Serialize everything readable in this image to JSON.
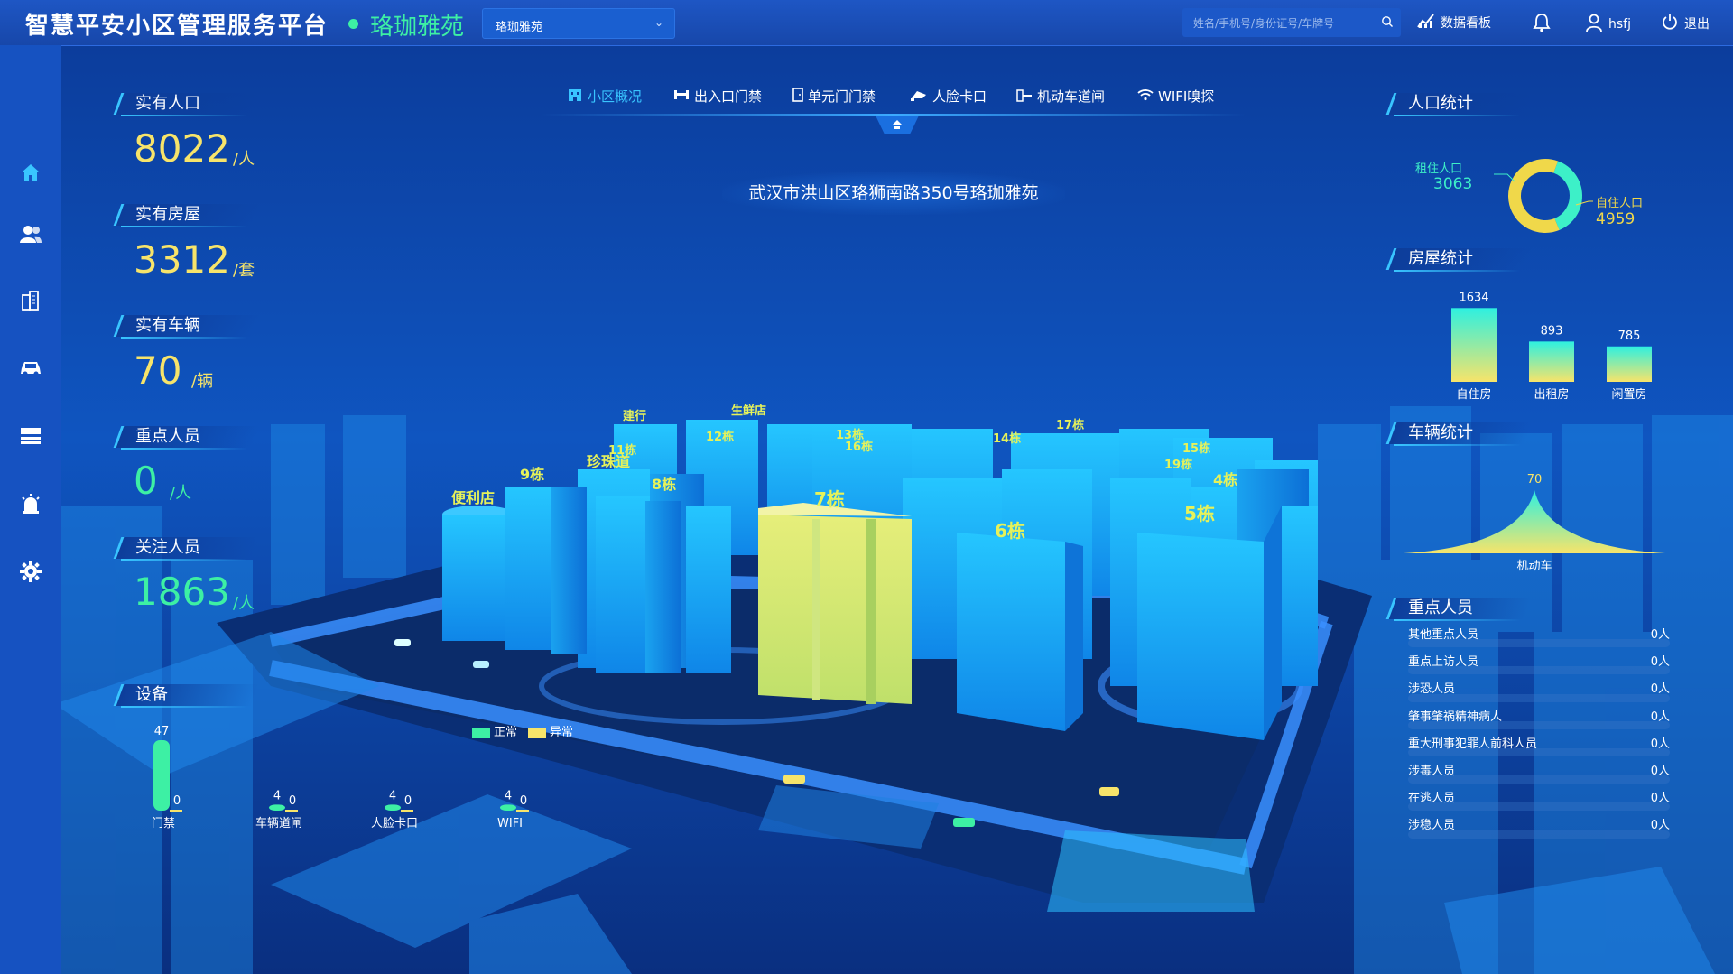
{
  "header": {
    "app_title": "智慧平安小区管理服务平台",
    "site_name": "珞珈雅苑",
    "site_select_value": "珞珈雅苑",
    "search_placeholder": "姓名/手机号/身份证号/车牌号",
    "dashboard_label": "数据看板",
    "username": "hsfj",
    "logout_label": "退出"
  },
  "sidebar": {
    "items": [
      "home-icon",
      "people-icon",
      "building-icon",
      "car-icon",
      "list-icon",
      "alarm-icon",
      "settings-icon"
    ]
  },
  "stats": [
    {
      "label": "实有人口",
      "value": "8022",
      "unit": "/人",
      "color": "#f7e46a"
    },
    {
      "label": "实有房屋",
      "value": "3312",
      "unit": "/套",
      "color": "#f7e46a"
    },
    {
      "label": "实有车辆",
      "value": "70",
      "unit": "/辆",
      "color": "#f7e46a"
    },
    {
      "label": "重点人员",
      "value": "0",
      "unit": "/人",
      "color": "#3df0a4"
    },
    {
      "label": "关注人员",
      "value": "1863",
      "unit": "/人",
      "color": "#3df0a4"
    }
  ],
  "nav_tabs": [
    {
      "label": "小区概况",
      "icon": "building-icon",
      "active": true
    },
    {
      "label": "出入口门禁",
      "icon": "gate-icon",
      "active": false
    },
    {
      "label": "单元门门禁",
      "icon": "door-icon",
      "active": false
    },
    {
      "label": "人脸卡口",
      "icon": "camera-icon",
      "active": false
    },
    {
      "label": "机动车道闸",
      "icon": "barrier-icon",
      "active": false
    },
    {
      "label": "WIFI嗅探",
      "icon": "wifi-icon",
      "active": false
    }
  ],
  "address": "武汉市洪山区珞狮南路350号珞珈雅苑",
  "building_labels": [
    "便利店",
    "9栋",
    "8栋",
    "7栋",
    "6栋",
    "5栋",
    "4栋",
    "建行",
    "生鲜店",
    "珍珠道",
    "11栋",
    "12栋",
    "13栋",
    "16栋",
    "14栋",
    "17栋",
    "15栋",
    "19栋"
  ],
  "legend": {
    "normal": "正常",
    "abnormal": "异常",
    "normal_color": "#3df0a4",
    "abnormal_color": "#f7e46a"
  },
  "devices": {
    "title": "设备",
    "items": [
      {
        "name": "门禁",
        "normal": 47,
        "abnormal": 0
      },
      {
        "name": "车辆道闸",
        "normal": 4,
        "abnormal": 0
      },
      {
        "name": "人脸卡口",
        "normal": 4,
        "abnormal": 0
      },
      {
        "name": "WIFI",
        "normal": 4,
        "abnormal": 0
      }
    ]
  },
  "population_chart": {
    "title": "人口统计",
    "chart_data": {
      "type": "pie",
      "categories": [
        "租住人口",
        "自住人口"
      ],
      "values": [
        3063,
        4959
      ],
      "colors": [
        "#3df0c8",
        "#f0d84a"
      ]
    }
  },
  "housing_chart": {
    "title": "房屋统计",
    "chart_data": {
      "type": "bar",
      "categories": [
        "自住房",
        "出租房",
        "闲置房"
      ],
      "values": [
        1634,
        893,
        785
      ]
    }
  },
  "vehicle_chart": {
    "title": "车辆统计",
    "chart_data": {
      "type": "area",
      "categories": [
        "机动车"
      ],
      "values": [
        70
      ]
    }
  },
  "key_persons": {
    "title": "重点人员",
    "rows": [
      {
        "name": "其他重点人员",
        "value": "0人"
      },
      {
        "name": "重点上访人员",
        "value": "0人"
      },
      {
        "name": "涉恐人员",
        "value": "0人"
      },
      {
        "name": "肇事肇祸精神病人",
        "value": "0人"
      },
      {
        "name": "重大刑事犯罪人前科人员",
        "value": "0人"
      },
      {
        "name": "涉毒人员",
        "value": "0人"
      },
      {
        "name": "在逃人员",
        "value": "0人"
      },
      {
        "name": "涉稳人员",
        "value": "0人"
      }
    ]
  }
}
